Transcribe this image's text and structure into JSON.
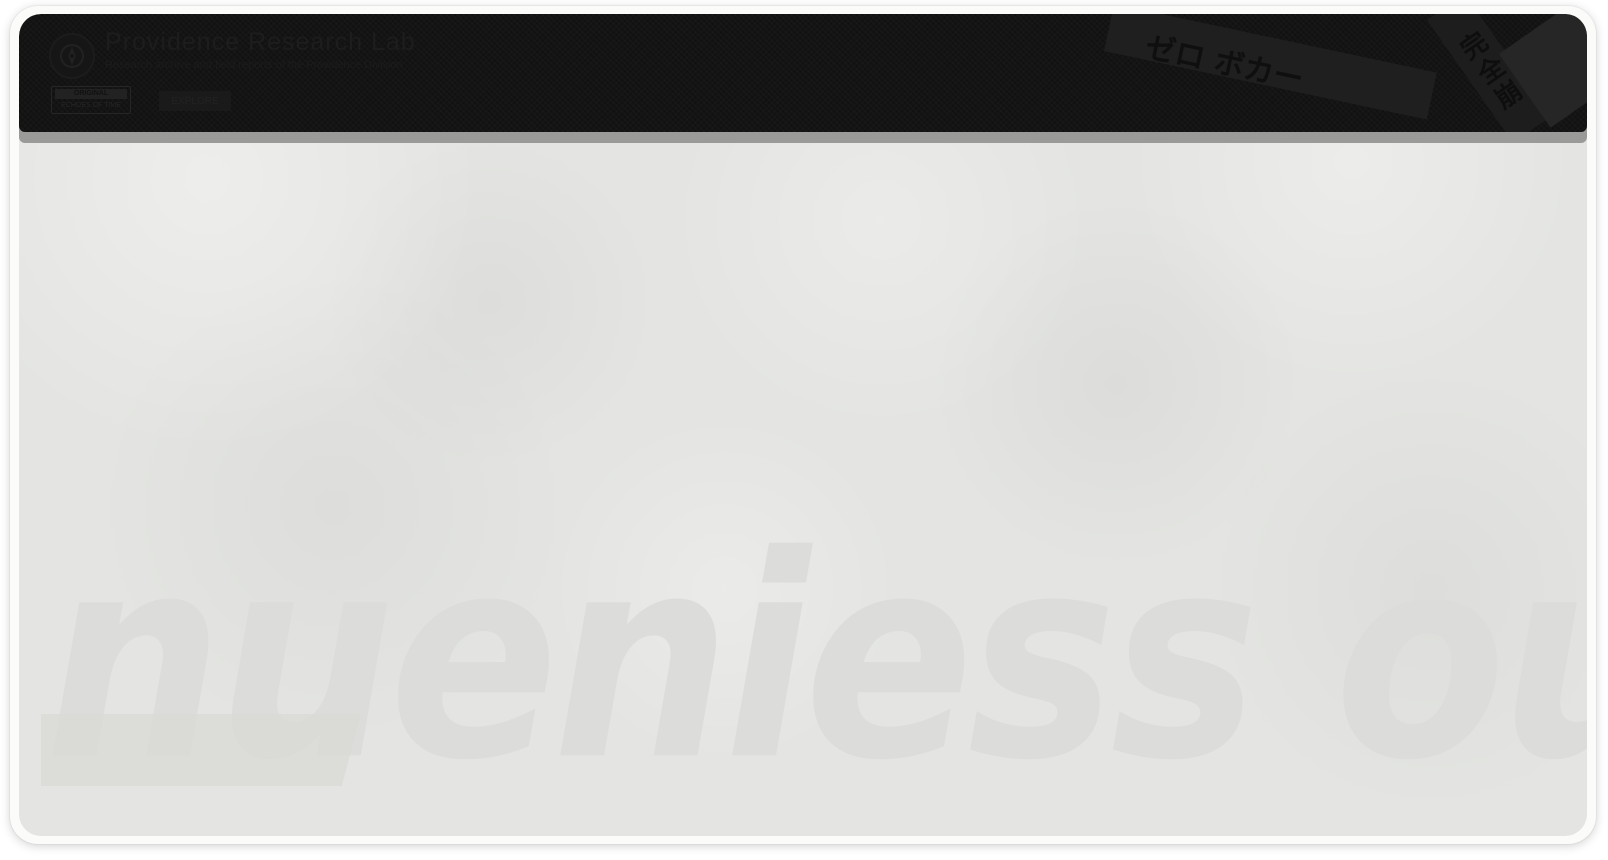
{
  "header": {
    "title": "Providence Research Lab",
    "subtitle": "Research archive and field reports of the Providence Division",
    "badge_top": "ORIGINAL",
    "badge_bottom": "ECHOES OF TIME",
    "tag_label": "EXPLORE"
  },
  "decor": {
    "strip_text": "ゼロ ボカー",
    "strip2_text": "完全崩",
    "watermark": "nueniess ou eueu"
  },
  "icons": {
    "logo": "emblem-icon"
  },
  "colors": {
    "header_bg": "#111111",
    "header_shadow": "#9a9b99",
    "panel_bg": "#e4e5e2",
    "watermark": "#dcdddb"
  }
}
